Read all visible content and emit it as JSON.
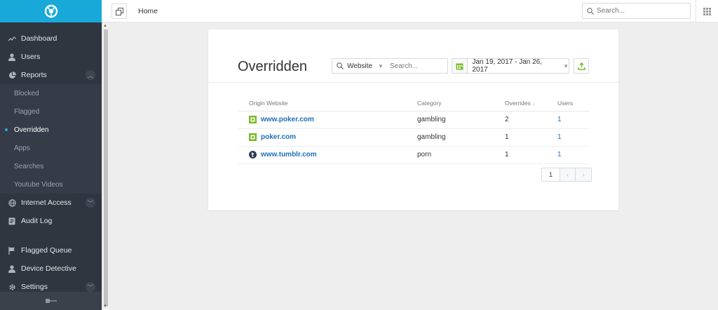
{
  "sidebar": {
    "logo": "app-logo",
    "items": [
      {
        "label": "Dashboard",
        "icon": "activity-icon"
      },
      {
        "label": "Users",
        "icon": "user-icon"
      },
      {
        "label": "Reports",
        "icon": "pie-chart-icon",
        "expanded": true
      },
      {
        "label": "Blocked"
      },
      {
        "label": "Flagged"
      },
      {
        "label": "Overridden",
        "active": true
      },
      {
        "label": "Apps"
      },
      {
        "label": "Searches"
      },
      {
        "label": "Youtube Videos"
      },
      {
        "label": "Internet Access",
        "icon": "globe-icon"
      },
      {
        "label": "Audit Log",
        "icon": "document-icon"
      },
      {
        "label": "Flagged Queue",
        "icon": "flag-icon"
      },
      {
        "label": "Device Detective",
        "icon": "user-icon"
      },
      {
        "label": "Settings",
        "icon": "gear-icon"
      }
    ]
  },
  "topbar": {
    "breadcrumb": "Home",
    "search_placeholder": "Search..."
  },
  "card": {
    "title": "Overridden",
    "filter": {
      "selected": "Website",
      "placeholder": "Search..."
    },
    "date_range": "Jan 19, 2017 - Jan 26, 2017",
    "columns": {
      "site": "Origin Website",
      "category": "Category",
      "overrides": "Overrides",
      "users": "Users"
    },
    "rows": [
      {
        "site": "www.poker.com",
        "category": "gambling",
        "overrides": "2",
        "users": "1",
        "icon": "poker-favicon"
      },
      {
        "site": "poker.com",
        "category": "gambling",
        "overrides": "1",
        "users": "1",
        "icon": "poker-favicon"
      },
      {
        "site": "www.tumblr.com",
        "category": "porn",
        "overrides": "1",
        "users": "1",
        "icon": "tumblr-favicon"
      }
    ],
    "pagination": {
      "page": "1"
    }
  },
  "colors": {
    "accent": "#18a9d9",
    "sidebar_bg": "#2f3640",
    "link": "#1d6fb8",
    "green": "#7ab929"
  }
}
